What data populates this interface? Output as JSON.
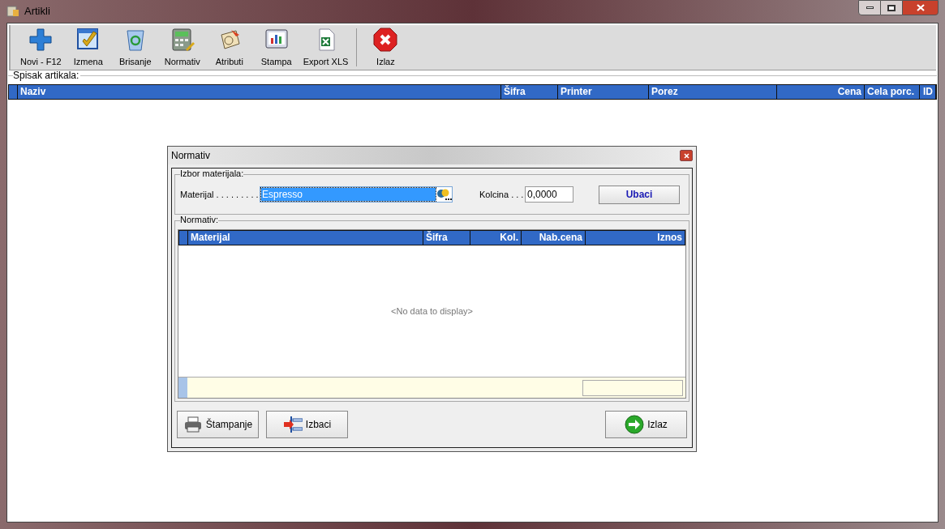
{
  "window": {
    "title": "Artikli"
  },
  "toolbar": [
    {
      "label": "Novi - F12",
      "kind": "new"
    },
    {
      "label": "Izmena",
      "kind": "edit"
    },
    {
      "label": "Brisanje",
      "kind": "delete"
    },
    {
      "label": "Normativ",
      "kind": "calc"
    },
    {
      "label": "Atributi",
      "kind": "attr"
    },
    {
      "label": "Stampa",
      "kind": "print"
    },
    {
      "label": "Export XLS",
      "kind": "xls"
    },
    {
      "label": "Izlaz",
      "kind": "exit"
    }
  ],
  "list": {
    "label": "Spisak artikala:",
    "columns": [
      {
        "label": "Naziv",
        "right_aligned": false
      },
      {
        "label": "Šifra",
        "right_aligned": false
      },
      {
        "label": "Printer",
        "right_aligned": false
      },
      {
        "label": "Porez",
        "right_aligned": false
      },
      {
        "label": "Cena",
        "right_aligned": true
      },
      {
        "label": "Cela porc.",
        "right_aligned": false
      },
      {
        "label": "ID",
        "right_aligned": true
      }
    ]
  },
  "dialog": {
    "title": "Normativ",
    "selection": {
      "label": "Izbor materijala:",
      "material_label": "Materijal . . . . . . . . .",
      "material_value": "Espresso",
      "material_text_selected": true,
      "quantity_label": "Kolcina . . .",
      "quantity_value": "0,0000",
      "add_button": "Ubaci"
    },
    "grid": {
      "label": "Normativ:",
      "columns": [
        {
          "label": "Materijal",
          "right_aligned": false
        },
        {
          "label": "Šifra",
          "right_aligned": false
        },
        {
          "label": "Kol.",
          "right_aligned": true
        },
        {
          "label": "Nab.cena",
          "right_aligned": true
        },
        {
          "label": "Iznos",
          "right_aligned": true
        }
      ],
      "empty_text": "<No data to display>"
    },
    "buttons": [
      {
        "label": "Štampanje",
        "kind": "print"
      },
      {
        "label": "Izbaci",
        "kind": "remove"
      },
      {
        "label": "Izlaz",
        "kind": "exit"
      }
    ]
  }
}
